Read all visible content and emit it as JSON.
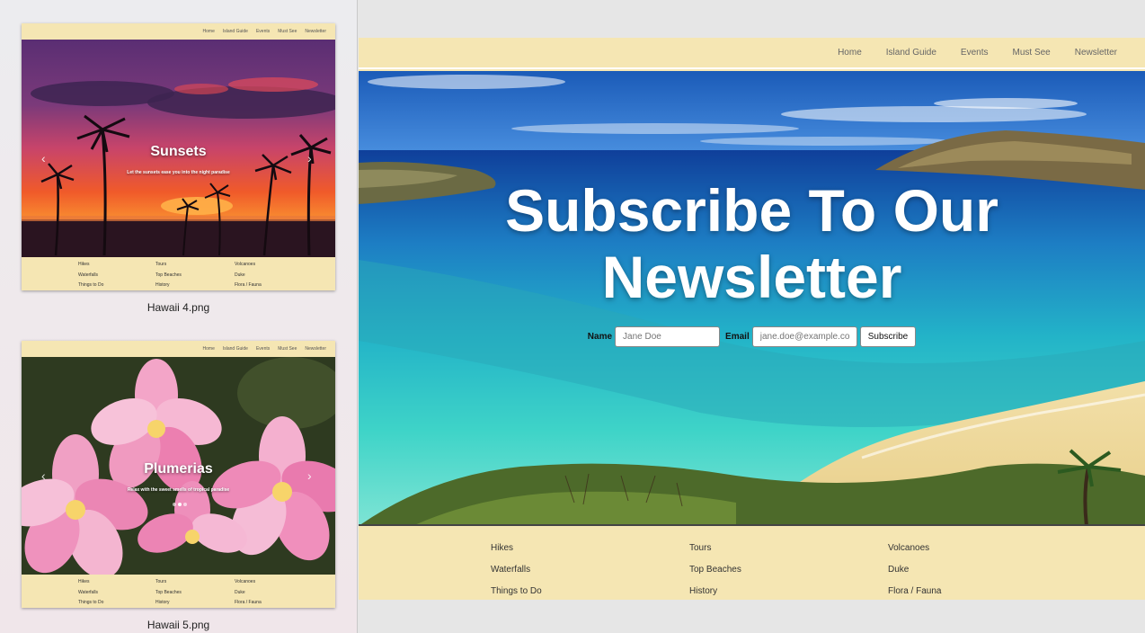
{
  "sidebar": {
    "thumbs": [
      {
        "caption": "Hawaii 4.png",
        "nav": [
          "Home",
          "Island Guide",
          "Events",
          "Must See",
          "Newsletter"
        ],
        "slide_title": "Sunsets",
        "slide_subtitle": "Let the sunsets ease you into the night paradise",
        "footer": {
          "col1": [
            "Hikes",
            "Waterfalls",
            "Things to Do"
          ],
          "col2": [
            "Tours",
            "Top Beaches",
            "History"
          ],
          "col3": [
            "Volcanoes",
            "Duke",
            "Flora / Fauna"
          ]
        }
      },
      {
        "caption": "Hawaii 5.png",
        "nav": [
          "Home",
          "Island Guide",
          "Events",
          "Must See",
          "Newsletter"
        ],
        "slide_title": "Plumerias",
        "slide_subtitle": "Relax with the sweet smells of tropical paradise",
        "footer": {
          "col1": [
            "Hikes",
            "Waterfalls",
            "Things to Do"
          ],
          "col2": [
            "Tours",
            "Top Beaches",
            "History"
          ],
          "col3": [
            "Volcanoes",
            "Duke",
            "Flora / Fauna"
          ]
        }
      }
    ]
  },
  "site": {
    "nav": [
      "Home",
      "Island Guide",
      "Events",
      "Must See",
      "Newsletter"
    ],
    "hero": {
      "title_line1": "Subscribe To Our",
      "title_line2": "Newsletter",
      "name_label": "Name",
      "name_placeholder": "Jane Doe",
      "email_label": "Email",
      "email_placeholder": "jane.doe@example.com",
      "subscribe_label": "Subscribe"
    },
    "footer": {
      "col1": [
        "Hikes",
        "Waterfalls",
        "Things to Do"
      ],
      "col2": [
        "Tours",
        "Top Beaches",
        "History"
      ],
      "col3": [
        "Volcanoes",
        "Duke",
        "Flora / Fauna"
      ]
    }
  },
  "colors": {
    "nav_bg": "#f5e6b3",
    "sidebar_bg": "#ececef"
  }
}
